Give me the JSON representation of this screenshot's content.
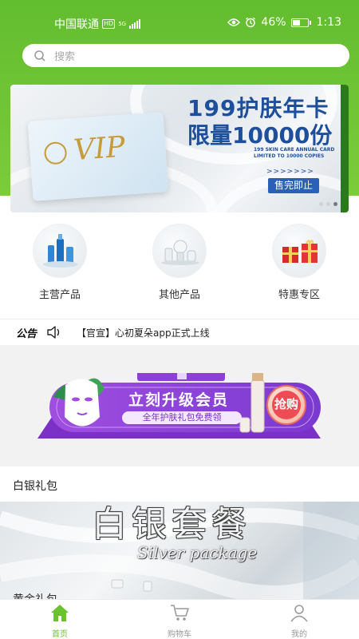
{
  "status_bar": {
    "carrier": "中国联通",
    "hd": "HD",
    "network": "5G",
    "battery": "46%",
    "battery_level": 0.46,
    "time": "1:13"
  },
  "search": {
    "placeholder": "搜索"
  },
  "banner": {
    "line1": "199护肤年卡",
    "line2": "限量10000份",
    "english_line1": "199 SKIN CARE ANNUAL CARD",
    "english_line2": "LIMITED TO 10000 COPIES",
    "arrows": ">>>>>>>",
    "cta": "售完即止",
    "card_text": "VIP"
  },
  "categories": [
    {
      "label": "主营产品",
      "icon": "skincare-bottles"
    },
    {
      "label": "其他产品",
      "icon": "cosmetics-set"
    },
    {
      "label": "特惠专区",
      "icon": "gift-boxes"
    }
  ],
  "notice": {
    "title": "公告",
    "text": "【官宣】心初夏朵app正式上线"
  },
  "promo": {
    "title": "立刻升级会员",
    "subtitle": "全年护肤礼包免费领",
    "button": "抢购"
  },
  "sections": [
    {
      "title": "白银礼包",
      "banner_title": "白银套餐",
      "banner_subtitle": "Silver package"
    },
    {
      "title": "黄金礼包"
    }
  ],
  "tabbar": {
    "items": [
      {
        "label": "首页",
        "icon": "home-icon",
        "active": true
      },
      {
        "label": "购物车",
        "icon": "cart-icon",
        "active": false
      },
      {
        "label": "我的",
        "icon": "user-icon",
        "active": false
      }
    ]
  },
  "colors": {
    "primary_green": "#6ac22f",
    "banner_blue": "#1e4f9c",
    "promo_purple": "#8a45d6"
  }
}
